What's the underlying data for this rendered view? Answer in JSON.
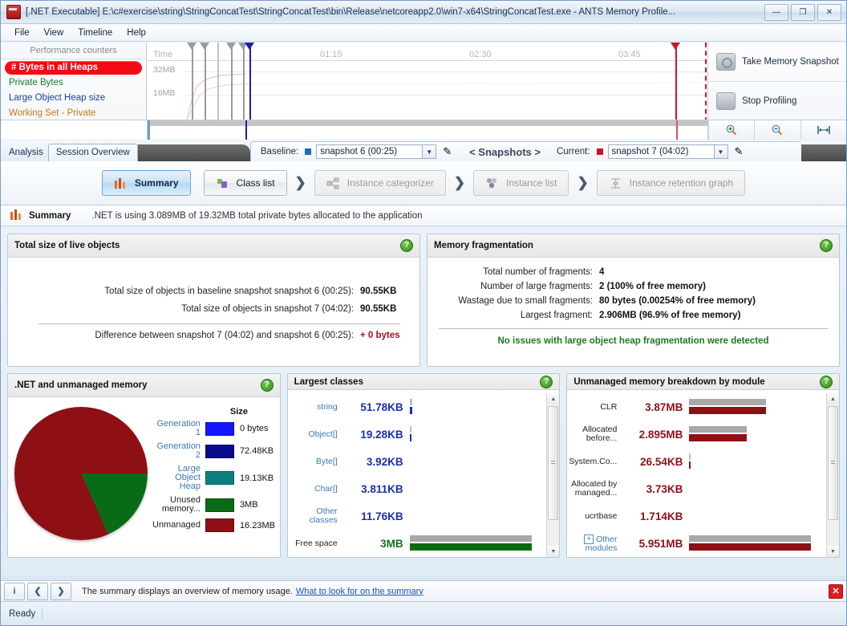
{
  "window": {
    "title": "[.NET Executable] E:\\c#exercise\\string\\StringConcatTest\\StringConcatTest\\bin\\Release\\netcoreapp2.0\\win7-x64\\StringConcatTest.exe - ANTS Memory Profile...",
    "minimize": "—",
    "maximize": "❐",
    "close": "✕"
  },
  "menu": [
    "File",
    "View",
    "Timeline",
    "Help"
  ],
  "counters": {
    "header": "Performance counters",
    "items": [
      {
        "label": "# Bytes in all Heaps",
        "color": "#ffffff",
        "selected": true
      },
      {
        "label": "Private Bytes",
        "color": "#127a2e",
        "selected": false
      },
      {
        "label": "Large Object Heap size",
        "color": "#1b3fa8",
        "selected": false
      },
      {
        "label": "Working Set - Private",
        "color": "#c77a14",
        "selected": false
      }
    ]
  },
  "timeline": {
    "time_label": "Time",
    "y_ticks": [
      "32MB",
      "16MB"
    ],
    "x_ticks": [
      "01:15",
      "02:30",
      "03:45"
    ],
    "take_snapshot_label": "Take Memory Snapshot",
    "stop_profiling_label": "Stop Profiling",
    "zoom_in_icon": "zoom-in-icon",
    "zoom_out_icon": "zoom-out-icon",
    "zoom_fit_icon": "zoom-fit-icon"
  },
  "tabs": {
    "analysis_label": "Analysis",
    "session_overview": "Session Overview"
  },
  "snapshot_bar": {
    "baseline_label": "Baseline:",
    "baseline_value": "snapshot 6 (00:25)",
    "snapshots_nav": "< Snapshots >",
    "current_label": "Current:",
    "current_value": "snapshot 7 (04:02)",
    "baseline_color": "#1d6fb8",
    "current_color": "#c81526",
    "edit_icon": "pencil-icon",
    "dropdown_icon": "chevron-down-icon"
  },
  "ribbon": {
    "buttons": [
      {
        "label": "Summary",
        "state": "active",
        "icon": "bar-chart-icon"
      },
      {
        "label": "Class list",
        "state": "enabled",
        "icon": "class-list-icon"
      },
      {
        "label": "Instance categorizer",
        "state": "disabled",
        "icon": "categorizer-icon"
      },
      {
        "label": "Instance list",
        "state": "disabled",
        "icon": "instance-list-icon"
      },
      {
        "label": "Instance retention graph",
        "state": "disabled",
        "icon": "retention-graph-icon"
      }
    ],
    "separator": "❯"
  },
  "summary_header": {
    "title": "Summary",
    "description": ".NET is using 3.089MB of 19.32MB total private bytes allocated to the application",
    "icon": "bar-chart-icon"
  },
  "panels": {
    "live_objects": {
      "title": "Total size of live objects",
      "rows": [
        {
          "label": "Total size of objects in baseline snapshot snapshot 6 (00:25):",
          "value": "90.55KB"
        },
        {
          "label": "Total size of objects in snapshot 7 (04:02):",
          "value": "90.55KB"
        }
      ],
      "difference": {
        "label": "Difference between snapshot 7 (04:02) and snapshot 6 (00:25):",
        "value": "+ 0 bytes"
      }
    },
    "fragmentation": {
      "title": "Memory fragmentation",
      "rows": [
        {
          "label": "Total number of fragments:",
          "value": "4"
        },
        {
          "label": "Number of large fragments:",
          "value": "2 (100% of free memory)"
        },
        {
          "label": "Wastage due to small fragments:",
          "value": "80 bytes (0.00254% of free memory)"
        },
        {
          "label": "Largest fragment:",
          "value": "2.906MB (96.9% of free memory)"
        }
      ],
      "status": "No issues with large object heap fragmentation were detected"
    },
    "dotnet_memory": {
      "title": ".NET and unmanaged memory",
      "size_header": "Size"
    },
    "largest_classes": {
      "title": "Largest classes"
    },
    "unmanaged_modules": {
      "title": "Unmanaged memory breakdown by module"
    }
  },
  "chart_data": [
    {
      "type": "pie",
      "title": ".NET and unmanaged memory",
      "labels": [
        "Generation 1",
        "Generation 2",
        "Large Object Heap",
        "Unused memory...",
        "Unmanaged"
      ],
      "values": [
        0,
        72.48,
        19.13,
        3072,
        16619.52
      ],
      "value_labels": [
        "0 bytes",
        "72.48KB",
        "19.13KB",
        "3MB",
        "16.23MB"
      ],
      "colors": [
        "#1414ff",
        "#0a0a8c",
        "#0d7f7f",
        "#0a6b16",
        "#8e0f14"
      ],
      "legend": "right"
    },
    {
      "type": "bar",
      "title": "Largest classes",
      "categories": [
        "string",
        "Object[]",
        "Byte[]",
        "Char[]",
        "Other classes",
        "Free space"
      ],
      "value_labels": [
        "51.78KB",
        "19.28KB",
        "3.92KB",
        "3.811KB",
        "11.76KB",
        "3MB"
      ],
      "values": [
        51.78,
        19.28,
        3.92,
        3.811,
        11.76,
        3072
      ],
      "bar_fill_pct": [
        1.6,
        0.6,
        0.12,
        0.12,
        0.36,
        100
      ],
      "colors": {
        "bar_top": "#a8a8a8",
        "bar_bottom": "#0c6b12"
      },
      "xlabel": "",
      "ylabel": ""
    },
    {
      "type": "bar",
      "title": "Unmanaged memory breakdown by module",
      "categories": [
        "CLR",
        "Allocated before...",
        "System.Co...",
        "Allocated by managed...",
        "ucrtbase",
        "Other modules"
      ],
      "value_labels": [
        "3.87MB",
        "2.895MB",
        "26.54KB",
        "3.73KB",
        "1.714KB",
        "5.951MB"
      ],
      "values": [
        3961.34,
        2964.48,
        26.54,
        3.73,
        1.714,
        6093.82
      ],
      "bar_fill_pct": [
        63,
        48,
        1,
        0,
        0,
        100
      ],
      "colors": {
        "bar_top": "#a8a8a8",
        "bar_bottom": "#8e0f14"
      },
      "xlabel": "",
      "ylabel": ""
    }
  ],
  "hint_bar": {
    "info_icon": "info-icon",
    "prev_icon": "chevron-left-icon",
    "next_icon": "chevron-right-icon",
    "text": "The summary displays an overview of memory usage.",
    "link": "What to look for on the summary",
    "close_icon": "close-icon"
  },
  "status_bar": {
    "text": "Ready"
  }
}
